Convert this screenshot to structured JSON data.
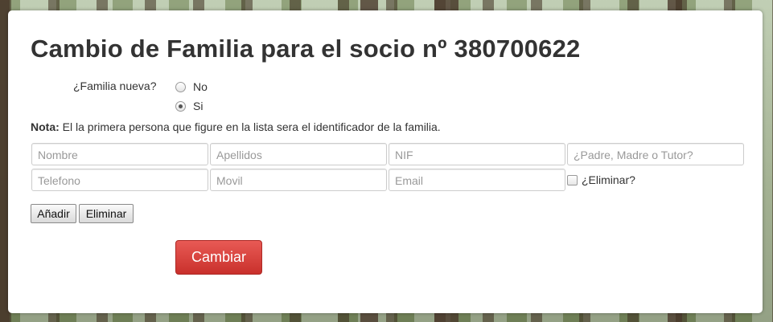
{
  "page": {
    "title": "Cambio de Familia para el socio nº 380700622"
  },
  "familia_nueva": {
    "label": "¿Familia nueva?",
    "options": [
      {
        "label": "No",
        "checked": false
      },
      {
        "label": "Si",
        "checked": true
      }
    ]
  },
  "nota": {
    "prefix": "Nota:",
    "text": " El la primera persona que figure en la lista sera el identificador de la familia."
  },
  "fields": {
    "nombre": "Nombre",
    "apellidos": "Apellidos",
    "nif": "NIF",
    "tutor": "¿Padre, Madre o Tutor?",
    "telefono": "Telefono",
    "movil": "Movil",
    "email": "Email"
  },
  "eliminar_check": {
    "label": "¿Eliminar?",
    "checked": false
  },
  "buttons": {
    "add": "Añadir",
    "remove": "Eliminar",
    "submit": "Cambiar"
  },
  "colors": {
    "submit_bg": "#d9534f",
    "text": "#333333",
    "placeholder": "#999999"
  }
}
